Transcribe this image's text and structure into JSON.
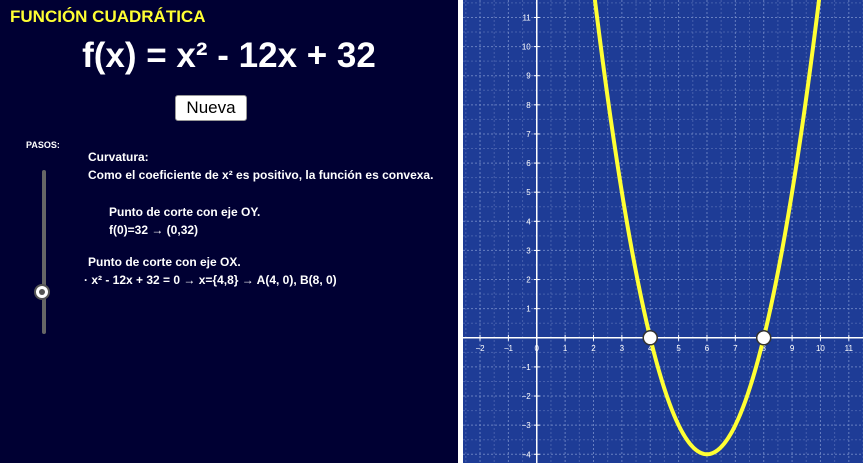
{
  "header": {
    "title": "FUNCIÓN CUADRÁTICA",
    "formula": "f(x) = x² - 12x + 32"
  },
  "controls": {
    "new_button": "Nueva",
    "steps_label": "PASOS:"
  },
  "steps": {
    "curvature_title": "Curvatura:",
    "curvature_text": "Como el coeficiente de x² es positivo, la función es convexa.",
    "oy_title": "Punto de corte con eje OY.",
    "oy_text": "f(0)=32 → (0,32)",
    "ox_title": "Punto de corte con eje OX.",
    "ox_text": "· x² - 12x + 32 = 0 → x={4,8} → A(4, 0), B(8, 0)"
  },
  "chart_data": {
    "type": "line",
    "function": "x^2 - 12x + 32",
    "xlim": [
      -2.6,
      11.5
    ],
    "ylim": [
      -4.3,
      11.6
    ],
    "x_ticks": [
      -2,
      -1,
      0,
      1,
      2,
      3,
      4,
      5,
      6,
      7,
      8,
      9,
      10,
      11
    ],
    "y_ticks": [
      -4,
      -3,
      -2,
      -1,
      1,
      2,
      3,
      4,
      5,
      6,
      7,
      8,
      9,
      10,
      11
    ],
    "points": [
      {
        "x": 4,
        "y": 0
      },
      {
        "x": 8,
        "y": 0
      }
    ],
    "vertex": {
      "x": 6,
      "y": -4
    },
    "grid": true,
    "colors": {
      "background": "#1e3c96",
      "grid": "#7f95cf",
      "curve": "#ffff33",
      "axes": "#ffffff"
    }
  }
}
